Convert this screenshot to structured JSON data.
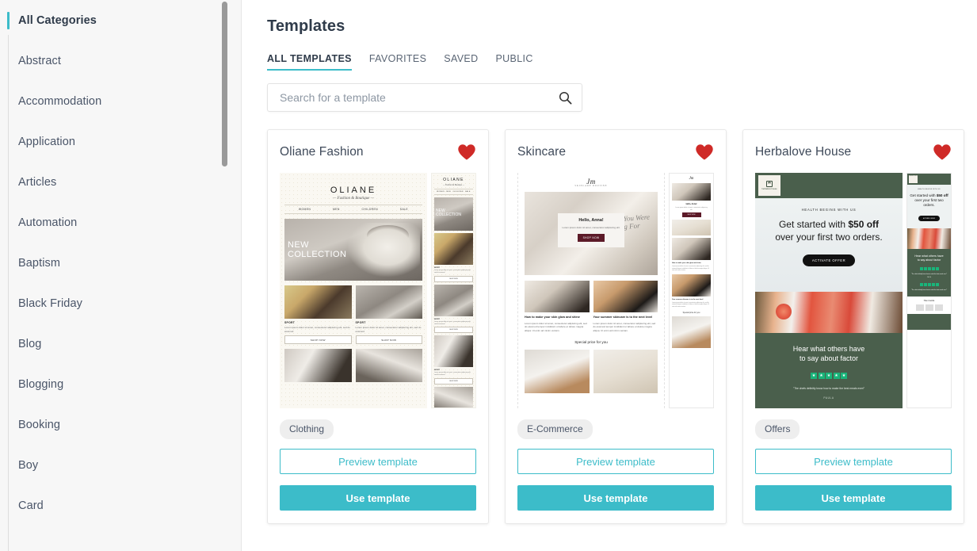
{
  "sidebar": {
    "scrollbar": {
      "visible": true
    },
    "items": [
      {
        "label": "All Categories",
        "active": true
      },
      {
        "label": "Abstract",
        "active": false
      },
      {
        "label": "Accommodation",
        "active": false
      },
      {
        "label": "Application",
        "active": false
      },
      {
        "label": "Articles",
        "active": false
      },
      {
        "label": "Automation",
        "active": false
      },
      {
        "label": "Baptism",
        "active": false
      },
      {
        "label": "Black Friday",
        "active": false
      },
      {
        "label": "Blog",
        "active": false
      },
      {
        "label": "Blogging",
        "active": false
      },
      {
        "label": "Booking",
        "active": false
      },
      {
        "label": "Boy",
        "active": false
      },
      {
        "label": "Card",
        "active": false
      }
    ]
  },
  "main": {
    "title": "Templates",
    "tabs": [
      {
        "label": "ALL TEMPLATES",
        "active": true
      },
      {
        "label": "FAVORITES",
        "active": false
      },
      {
        "label": "SAVED",
        "active": false
      },
      {
        "label": "PUBLIC",
        "active": false
      }
    ],
    "search": {
      "placeholder": "Search for a template",
      "value": "",
      "icon": "search-icon"
    },
    "card_actions": {
      "preview_label": "Preview template",
      "use_label": "Use template",
      "favorite_icon": "heart-icon"
    },
    "cards": [
      {
        "title": "Oliane Fashion",
        "tag": "Clothing",
        "favorited": true,
        "preview": {
          "brand": "OLIANE",
          "brand_sub": "— Fashion & Boutique —",
          "nav": [
            "WOMEN",
            "MEN",
            "CHILDREN",
            "SALE"
          ],
          "hero_line1": "NEW",
          "hero_line2": "COLLECTION",
          "section_label": "SPORT",
          "body_text": "Lorem ipsum dolor sit amet, consectetur adipiscing elit, sed do eiusmod",
          "button_label": "SHOP NOW"
        }
      },
      {
        "title": "Skincare",
        "tag": "E-Commerce",
        "favorited": true,
        "preview": {
          "brand": "Jm",
          "brand_sub": "SKINCARE ROUTINE",
          "greeting": "Hello, Anna!",
          "body_text": "Lorem ipsum dolor sit amet, consectetur adipiscing elit.",
          "button_label": "SHOP NOW",
          "script_text": "You Knew You Were Looking For",
          "article1_title": "How to make your skin glow and shine",
          "article2_title": "Your summer skincare is to the next level",
          "article_body": "Lorem ipsum dolor sit amet, consectetur adipiscing elit, sed do eiusmod tempor incididunt ut labore et dolore magna aliqua. Ut enim ad minim veniam.",
          "special_title": "Special price for you"
        }
      },
      {
        "title": "Herbalove House",
        "tag": "Offers",
        "favorited": true,
        "preview": {
          "logo_text": "herbalove house",
          "kicker": "HEALTH BEGINS WITH US",
          "headline_pre": "Get started with ",
          "headline_strong": "$50 off",
          "headline_post": "over your first two orders.",
          "cta_label": "ACTIVATE OFFER",
          "testimonial_headline_1": "Hear what others have",
          "testimonial_headline_2": "to say about factor",
          "stars": 5,
          "quote": "\"The chefs definitly know how to make the best meals ever!\"",
          "quote_author": "PAULA"
        }
      }
    ]
  },
  "colors": {
    "accent": "#3cbcc9",
    "favorite": "#cf2a27",
    "sidebar_bg": "#f7f7f7",
    "text": "#4a5568"
  }
}
